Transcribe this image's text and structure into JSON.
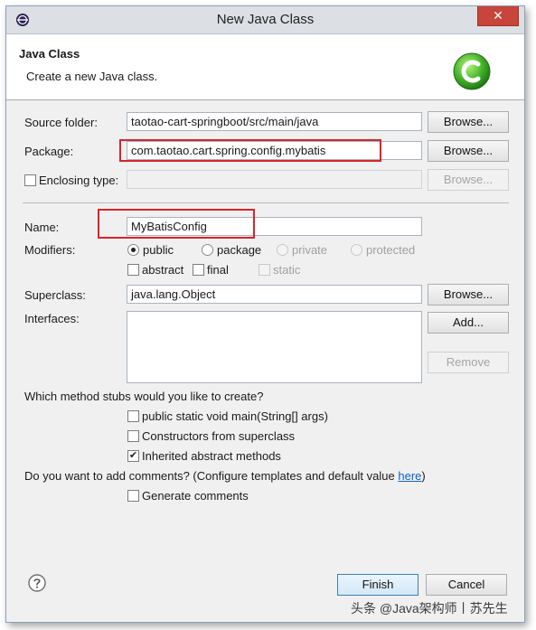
{
  "window": {
    "title": "New Java Class",
    "close_label": "✕"
  },
  "banner": {
    "title": "Java Class",
    "description": "Create a new Java class."
  },
  "form": {
    "source_folder": {
      "label": "Source folder:",
      "value": "taotao-cart-springboot/src/main/java",
      "browse": "Browse..."
    },
    "package": {
      "label": "Package:",
      "value": "com.taotao.cart.spring.config.mybatis",
      "browse": "Browse..."
    },
    "enclosing_type": {
      "label": "Enclosing type:",
      "value": "",
      "browse": "Browse...",
      "checked": false
    },
    "name": {
      "label": "Name:",
      "value": "MyBatisConfig"
    },
    "modifiers": {
      "label": "Modifiers:",
      "radios": [
        "public",
        "package",
        "private",
        "protected"
      ],
      "selected": "public",
      "checks": [
        "abstract",
        "final",
        "static"
      ]
    },
    "superclass": {
      "label": "Superclass:",
      "value": "java.lang.Object",
      "browse": "Browse..."
    },
    "interfaces": {
      "label": "Interfaces:",
      "add": "Add...",
      "remove": "Remove"
    }
  },
  "stubs": {
    "question": "Which method stubs would you like to create?",
    "options": [
      {
        "label": "public static void main(String[] args)",
        "checked": false
      },
      {
        "label": "Constructors from superclass",
        "checked": false
      },
      {
        "label": "Inherited abstract methods",
        "checked": true
      }
    ]
  },
  "comments": {
    "question": "Do you want to add comments? (Configure templates and default value ",
    "link": "here",
    "close": ")",
    "generate_label": "Generate comments"
  },
  "footer": {
    "finish": "Finish",
    "cancel": "Cancel"
  },
  "watermark": "头条 @Java架构师丨苏先生",
  "colors": {
    "highlight": "#d9232a",
    "close_button": "#c7453a",
    "link": "#0b63c5"
  }
}
